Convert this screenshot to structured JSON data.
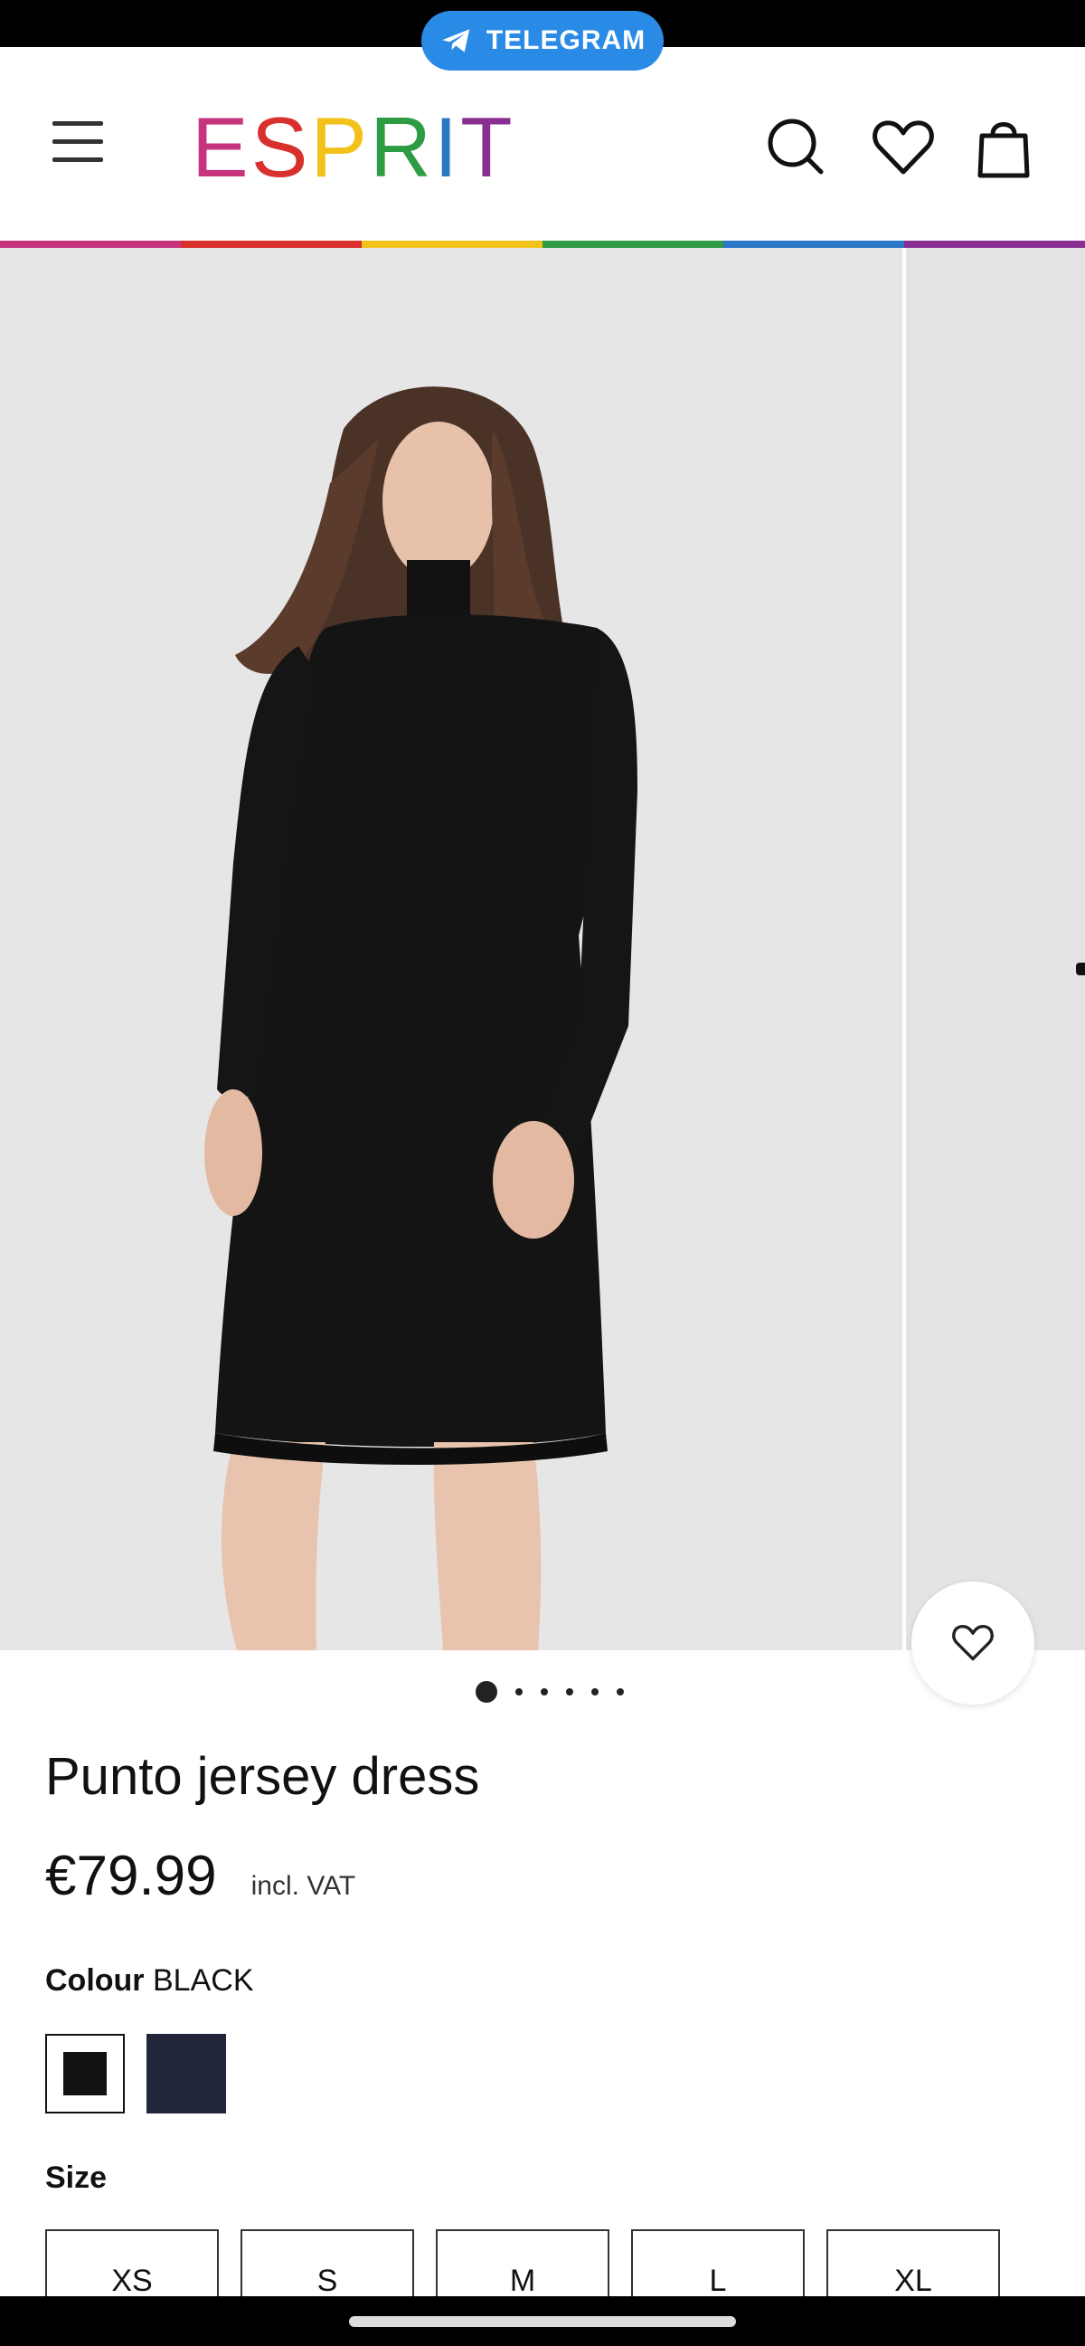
{
  "status_bar": {
    "telegram_label": "TELEGRAM"
  },
  "header": {
    "logo_letters": [
      "E",
      "S",
      "P",
      "R",
      "I",
      "T"
    ],
    "logo_colors": [
      "#c6347d",
      "#d8302f",
      "#f2c21b",
      "#2e9c45",
      "#2b78c8",
      "#8a2f91"
    ],
    "icons": [
      "menu-icon",
      "search-icon",
      "heart-icon",
      "shopping-bag-icon"
    ]
  },
  "rainbow_colors": [
    "#c6347d",
    "#d8302f",
    "#f2c21b",
    "#2e9c45",
    "#2b78c8",
    "#8a2f91"
  ],
  "gallery": {
    "image_count": 6,
    "active_index": 0
  },
  "product": {
    "title": "Punto jersey dress",
    "price": "€79.99",
    "vat_note": "incl. VAT",
    "colour_label": "Colour",
    "colour_value": "BLACK",
    "swatches": [
      {
        "name": "black",
        "color": "#111111",
        "selected": true
      },
      {
        "name": "navy",
        "color": "#22263a",
        "selected": false
      }
    ],
    "size_label": "Size",
    "sizes": [
      "XS",
      "S",
      "M",
      "L",
      "XL"
    ]
  }
}
